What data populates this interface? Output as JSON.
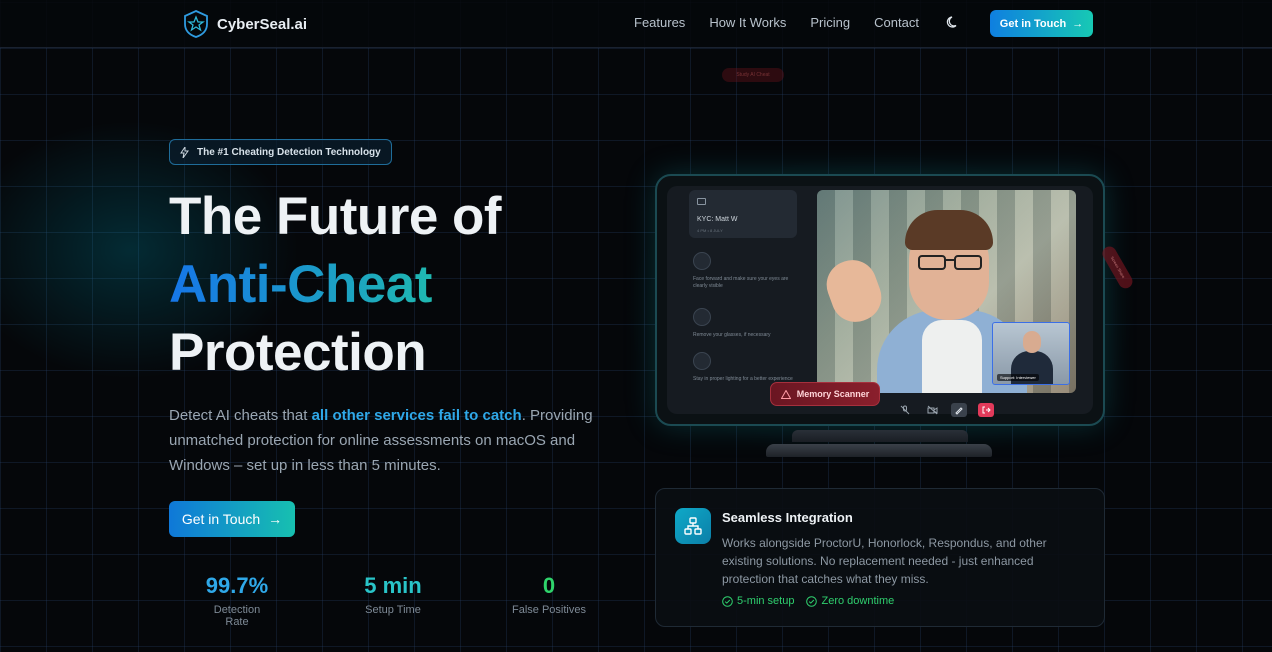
{
  "brand": {
    "name": "CyberSeal.ai"
  },
  "nav": {
    "links": [
      "Features",
      "How It Works",
      "Pricing",
      "Contact"
    ],
    "cta_label": "Get in Touch"
  },
  "hero": {
    "pill": "The #1 Cheating Detection Technology",
    "title_line1": "The Future of",
    "title_line2": "Anti-Cheat",
    "title_line3": "Protection",
    "desc_pre": "Detect AI cheats that ",
    "desc_highlight": "all other services fail to catch",
    "desc_post": ". Providing unmatched protection for online assessments on macOS and Windows – set up in less than 5 minutes.",
    "cta_label": "Get in Touch"
  },
  "stats": [
    {
      "value": "99.7%",
      "label": "Detection Rate",
      "color": "#2fa8e8"
    },
    {
      "value": "5 min",
      "label": "Setup Time",
      "color": "#29c4c8"
    },
    {
      "value": "0",
      "label": "False Positives",
      "color": "#2fd36b"
    }
  ],
  "mockup": {
    "ghost_badge": "Study AI Cheat",
    "kyc_title": "KYC: Matt W",
    "kyc_sub": "4 PM • 8 JULY",
    "steps": [
      "Face forward and make sure your eyes are clearly visible",
      "Remove your glasses, if necessary",
      "Stay in proper lighting for a better experience"
    ],
    "pip_label": "Support: Interviewer",
    "memory_scanner": "Memory Scanner",
    "side_badge": "Screen Share"
  },
  "integration": {
    "title": "Seamless Integration",
    "text": "Works alongside ProctorU, Honorlock, Respondus, and other existing solutions. No replacement needed - just enhanced protection that catches what they miss.",
    "tags": [
      "5-min setup",
      "Zero downtime"
    ]
  }
}
